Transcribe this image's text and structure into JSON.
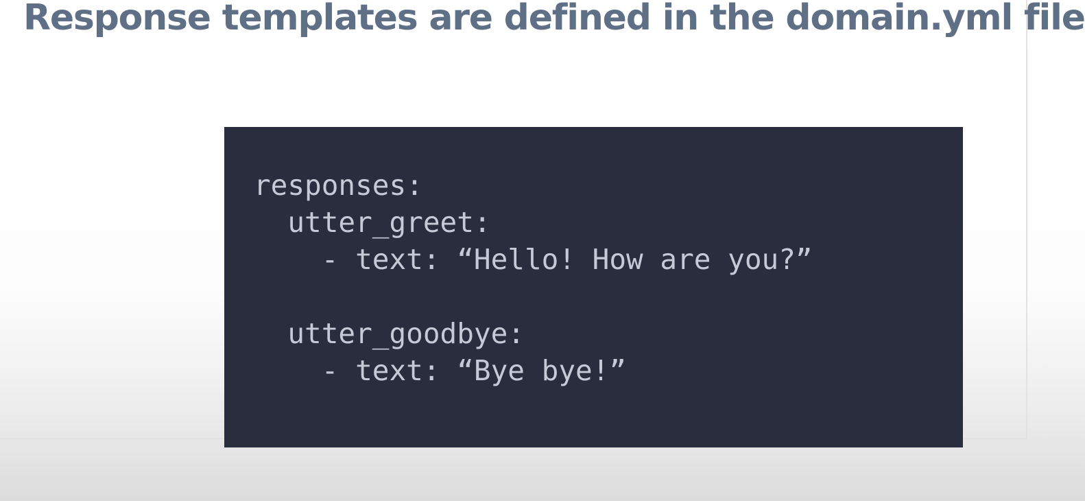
{
  "slide": {
    "title": "Response templates are defined in the domain.yml file"
  },
  "code_block": {
    "lines": [
      "responses:",
      "  utter_greet:",
      "    - text: “Hello! How are you?”",
      "",
      "  utter_goodbye:",
      "    - text: “Bye bye!”"
    ]
  },
  "colors": {
    "title": "#5e6f86",
    "code_background": "#2a2d3e",
    "code_text": "#c6c9d6"
  }
}
